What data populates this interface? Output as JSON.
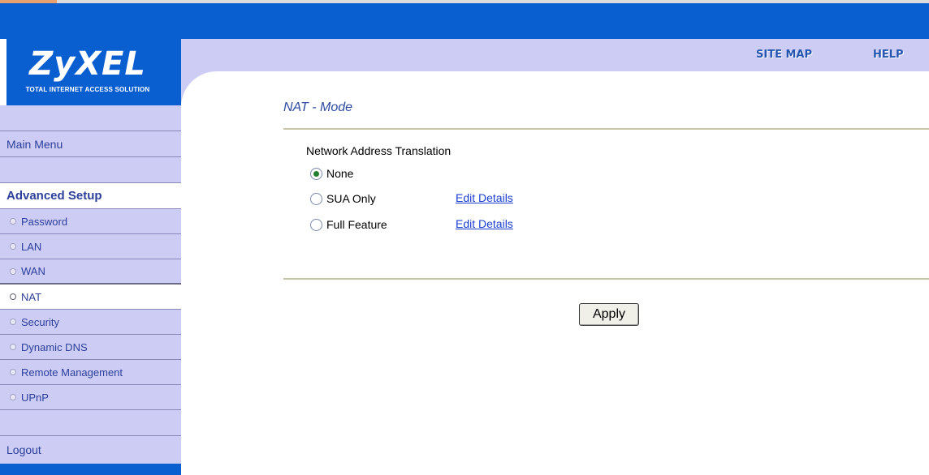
{
  "brand": {
    "name": "ZyXEL",
    "tagline": "TOTAL INTERNET ACCESS SOLUTION"
  },
  "topnav": {
    "site_map": "SITE MAP",
    "help": "HELP"
  },
  "sidebar": {
    "main_menu": "Main Menu",
    "advanced_setup": "Advanced Setup",
    "items": [
      {
        "label": "Password"
      },
      {
        "label": "LAN"
      },
      {
        "label": "WAN"
      },
      {
        "label": "NAT"
      },
      {
        "label": "Security"
      },
      {
        "label": "Dynamic DNS"
      },
      {
        "label": "Remote Management"
      },
      {
        "label": "UPnP"
      }
    ],
    "active_item": "NAT",
    "logout": "Logout"
  },
  "main": {
    "title": "NAT - Mode",
    "section_label": "Network Address Translation",
    "options": [
      {
        "label": "None",
        "checked": true
      },
      {
        "label": "SUA Only",
        "checked": false,
        "link": "Edit Details"
      },
      {
        "label": "Full Feature",
        "checked": false,
        "link": "Edit Details"
      }
    ],
    "apply_label": "Apply"
  },
  "colors": {
    "header_blue": "#0a5fd0",
    "nav_lavender": "#ccccf4",
    "title_blue": "#2c4aa0",
    "link_blue": "#1a3fd0"
  }
}
